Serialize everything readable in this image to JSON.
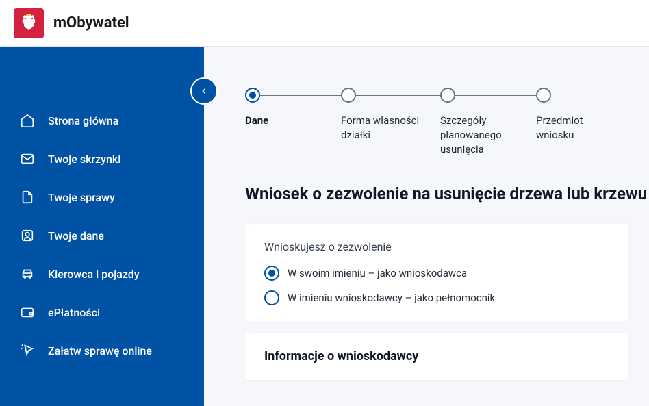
{
  "header": {
    "app_title": "mObywatel"
  },
  "sidebar": {
    "items": [
      {
        "label": "Strona główna"
      },
      {
        "label": "Twoje skrzynki"
      },
      {
        "label": "Twoje sprawy"
      },
      {
        "label": "Twoje dane"
      },
      {
        "label": "Kierowca i pojazdy"
      },
      {
        "label": "ePłatności"
      },
      {
        "label": "Załatw sprawę online"
      }
    ]
  },
  "stepper": {
    "steps": [
      {
        "label": "Dane"
      },
      {
        "label": "Forma własności działki"
      },
      {
        "label": "Szczegóły planowanego usunięcia"
      },
      {
        "label": "Przedmiot wniosku"
      }
    ]
  },
  "main": {
    "title": "Wniosek o zezwolenie na usunięcie drzewa lub krzewu",
    "permission_card": {
      "title": "Wnioskujesz o zezwolenie",
      "options": [
        {
          "label": "W swoim imieniu – jako wnioskodawca"
        },
        {
          "label": "W imieniu wnioskodawcy – jako pełnomocnik"
        }
      ]
    },
    "applicant_section": {
      "title": "Informacje o wnioskodawcy"
    }
  }
}
